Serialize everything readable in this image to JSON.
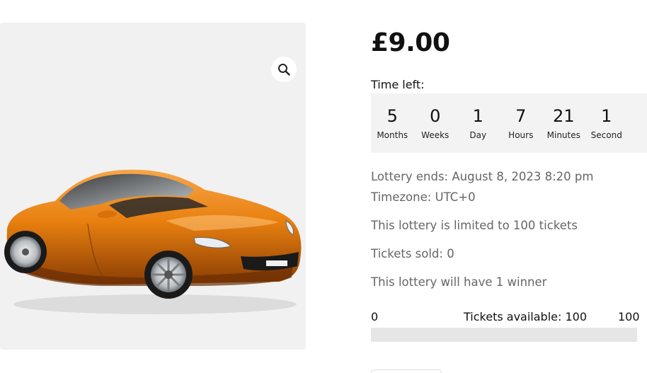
{
  "product": {
    "image_alt": "Orange sports car",
    "zoom_icon": "magnifier-icon"
  },
  "price": "£9.00",
  "countdown": {
    "label": "Time left:",
    "units": [
      {
        "value": "5",
        "label": "Months"
      },
      {
        "value": "0",
        "label": "Weeks"
      },
      {
        "value": "1",
        "label": "Day"
      },
      {
        "value": "7",
        "label": "Hours"
      },
      {
        "value": "21",
        "label": "Minutes"
      },
      {
        "value": "1",
        "label": "Second"
      }
    ]
  },
  "details": {
    "ends": "Lottery ends: August 8, 2023 8:20 pm",
    "timezone": "Timezone: UTC+0",
    "limit": "This lottery is limited to 100 tickets",
    "sold": "Tickets sold: 0",
    "winners": "This lottery will have 1 winner"
  },
  "progress": {
    "min": "0",
    "available": "Tickets available: 100",
    "max": "100",
    "fraction": 0
  },
  "colors": {
    "car_body": "#e8800f",
    "panel_bg": "#f1f1f1",
    "countdown_bg": "#f3f3f3"
  }
}
